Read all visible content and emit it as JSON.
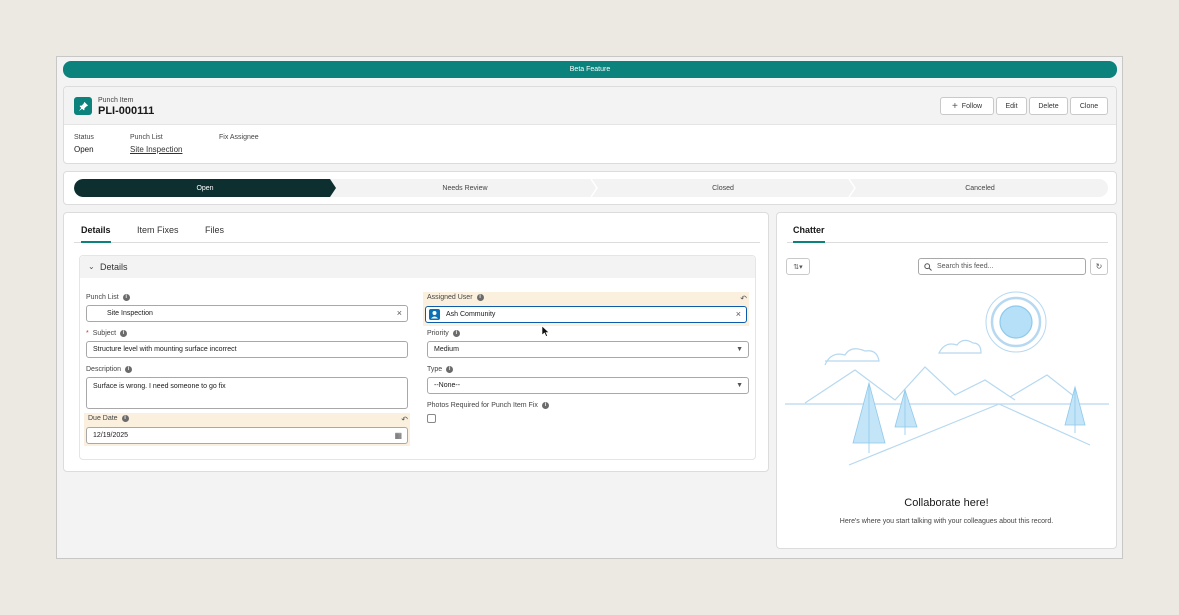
{
  "banner": {
    "label": "Beta Feature"
  },
  "record": {
    "type_label": "Punch Item",
    "name": "PLI-000111",
    "icon": "pin-icon"
  },
  "actions": {
    "follow": "Follow",
    "edit": "Edit",
    "delete": "Delete",
    "clone": "Clone"
  },
  "highlights": {
    "status_label": "Status",
    "status_value": "Open",
    "punch_list_label": "Punch List",
    "punch_list_value": "Site Inspection",
    "fix_assignee_label": "Fix Assignee",
    "fix_assignee_value": ""
  },
  "path": {
    "steps": [
      "Open",
      "Needs Review",
      "Closed",
      "Canceled"
    ],
    "active_index": 0
  },
  "tabs": [
    "Details",
    "Item Fixes",
    "Files"
  ],
  "details": {
    "section_title": "Details",
    "punch_list": {
      "label": "Punch List",
      "value": "Site Inspection"
    },
    "subject": {
      "label": "Subject",
      "required_mark": "*",
      "value": "Structure level with mounting surface incorrect"
    },
    "description": {
      "label": "Description",
      "value": "Surface is wrong. I need someone to go fix"
    },
    "due_date": {
      "label": "Due Date",
      "value": "12/19/2025"
    },
    "assigned_user": {
      "label": "Assigned User",
      "value": "Ash Community"
    },
    "priority": {
      "label": "Priority",
      "value": "Medium"
    },
    "type": {
      "label": "Type",
      "value": "--None--"
    },
    "photos_required": {
      "label": "Photos Required for Punch Item Fix",
      "checked": false
    }
  },
  "chatter": {
    "tab_label": "Chatter",
    "search_placeholder": "Search this feed...",
    "empty_title": "Collaborate here!",
    "empty_subtitle": "Here's where you start talking with your colleagues about this record."
  },
  "colors": {
    "brand": "#0b827c",
    "path_active": "#0e2f2f",
    "highlight": "#fbf0dd"
  }
}
